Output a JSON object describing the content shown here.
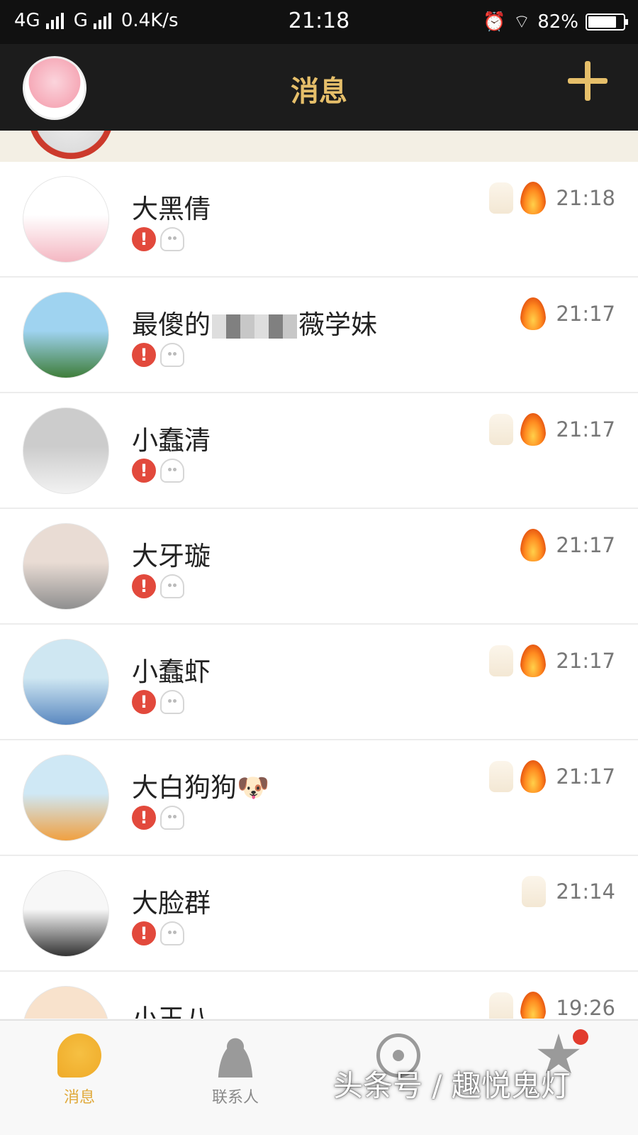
{
  "status_bar": {
    "network_1": "4G",
    "network_2": "G",
    "speed": "0.4K/s",
    "time": "21:18",
    "battery": "82%",
    "battery_level": 0.82,
    "icons": [
      "alarm-icon",
      "wifi-icon",
      "battery-icon"
    ]
  },
  "header": {
    "title": "消息",
    "icons": [
      "avatar",
      "plus-icon"
    ]
  },
  "conversations": [
    {
      "name": "大黑倩",
      "time": "21:18",
      "has_hand": true
    },
    {
      "name_before": "最傻的",
      "name_after": "薇学妹",
      "time": "21:17",
      "has_hand": false
    },
    {
      "name": "小蠢清",
      "time": "21:17",
      "has_hand": true
    },
    {
      "name": "大牙璇",
      "time": "21:17",
      "has_hand": false
    },
    {
      "name": "小蠢虾",
      "time": "21:17",
      "has_hand": true
    },
    {
      "name": "大白狗狗🐶",
      "time": "21:17",
      "has_hand": true
    },
    {
      "name": "大脸群",
      "time": "21:14",
      "has_hand": true,
      "no_fire": true
    },
    {
      "name": "小王八",
      "time": "19:26",
      "has_hand": true
    }
  ],
  "badge_alert_text": "!",
  "tabs": [
    {
      "label": "消息",
      "icon": "message-bubble-icon",
      "active": true
    },
    {
      "label": "联系人",
      "icon": "contacts-icon",
      "active": false
    },
    {
      "label": "",
      "icon": "discover-eye-icon",
      "active": false
    },
    {
      "label": "",
      "icon": "star-icon",
      "active": false,
      "has_dot": true
    }
  ],
  "watermark": "头条号 / 趣悦鬼灯",
  "colors": {
    "accent": "#e6bf6a",
    "header_bg": "#1c1c1c",
    "alert": "#e2493c"
  }
}
